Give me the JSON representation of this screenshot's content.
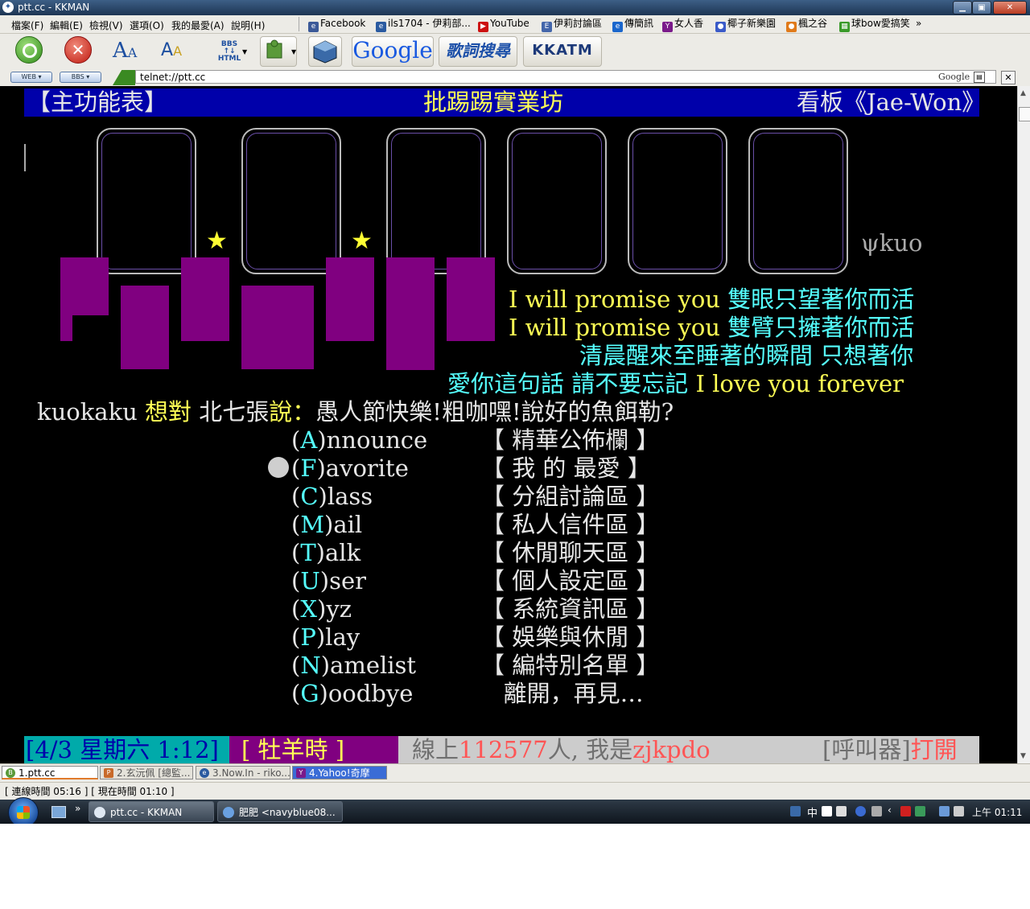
{
  "window": {
    "title": "ptt.cc - KKMAN"
  },
  "menu": {
    "items": [
      "檔案(F)",
      "編輯(E)",
      "檢視(V)",
      "選項(O)",
      "我的最愛(A)",
      "說明(H)"
    ]
  },
  "links": {
    "items": [
      "Facebook",
      "ils1704 - 伊莉部...",
      "YouTube",
      "伊莉討論區",
      "傳簡訊",
      "女人香",
      "椰子新樂園",
      "楓之谷",
      "球bow愛搞笑"
    ],
    "more": "»"
  },
  "toolbar": {
    "html_top": "BBS",
    "html_mid": "↑↓",
    "html_bottom": "HTML",
    "google": "Google",
    "lyric_search": "歌詞搜尋",
    "kkatm": "KKATM"
  },
  "addressbar": {
    "web_mode": "WEB",
    "bbs_mode": "BBS",
    "url": "telnet://ptt.cc",
    "search_engine": "Google"
  },
  "terminal": {
    "header": {
      "left": "【主功能表】",
      "center": "批踢踢實業坊",
      "right": "看板《Jae-Won》"
    },
    "art_signature": "ψkuo",
    "lyrics": [
      {
        "en": "I will promise you ",
        "zh": "雙眼只望著你而活"
      },
      {
        "en": "I will promise you ",
        "zh": "雙臂只擁著你而活"
      }
    ],
    "lyric3": "清晨醒來至睡著的瞬間 只想著你",
    "lyric4_zh": "愛你這句話 請不要忘記 ",
    "lyric4_en": "I love you forever",
    "message": {
      "from": "kuokaku ",
      "want": "想對 ",
      "to": "北七張",
      "say": "說：",
      "text": "愚人節快樂!粗咖嘿!說好的魚餌勒?"
    },
    "menu": [
      {
        "key": "A",
        "rest": "nnounce",
        "desc": "【 精華公佈欄 】"
      },
      {
        "key": "F",
        "rest": "avorite",
        "desc": "【 我 的 最愛 】"
      },
      {
        "key": "C",
        "rest": "lass",
        "desc": "【 分組討論區 】"
      },
      {
        "key": "M",
        "rest": "ail",
        "desc": "【 私人信件區 】"
      },
      {
        "key": "T",
        "rest": "alk",
        "desc": "【 休閒聊天區 】"
      },
      {
        "key": "U",
        "rest": "ser",
        "desc": "【 個人設定區 】"
      },
      {
        "key": "X",
        "rest": "yz",
        "desc": "【 系統資訊區 】"
      },
      {
        "key": "P",
        "rest": "lay",
        "desc": "【 娛樂與休閒 】"
      },
      {
        "key": "N",
        "rest": "amelist",
        "desc": "【 編特別名單 】"
      },
      {
        "key": "G",
        "rest": "oodbye",
        "desc": "   離開，再見…"
      }
    ],
    "status": {
      "date": "[4/3 星期六 1:12]",
      "hour": "[ 牡羊時 ]",
      "online_label": "線上",
      "online_count": "112577",
      "online_unit": "人, 我是",
      "user": "zjkpdo",
      "pager_label": "[呼叫器]",
      "pager_state": "打開"
    }
  },
  "tabs": [
    {
      "label": "1.ptt.cc"
    },
    {
      "label": "2.玄沅佩 [總監..."
    },
    {
      "label": "3.Now.In - riko..."
    },
    {
      "label": "4.Yahoo!奇摩"
    }
  ],
  "statusbar": {
    "text": "[ 連線時間 05:16 ] [ 現在時間 01:10 ]"
  },
  "taskbar": {
    "buttons": [
      "ptt.cc - KKMAN",
      "肥肥 <navyblue08..."
    ],
    "ime": "中",
    "clock": "上午 01:11"
  },
  "colors": {
    "header_bg": "#0000aa",
    "promise_purple": "#800080",
    "cyan": "#55ffff",
    "yellow": "#ffff55"
  }
}
